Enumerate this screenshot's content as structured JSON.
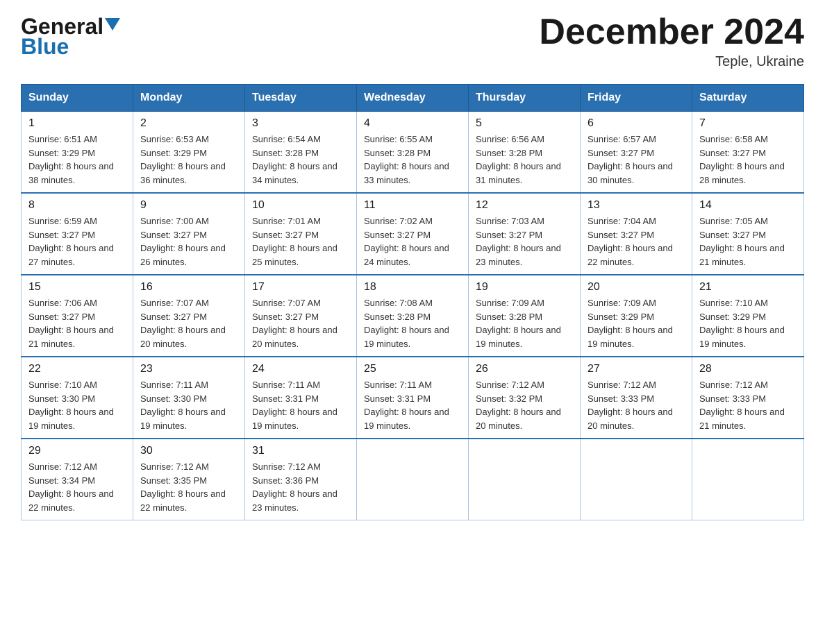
{
  "logo": {
    "general": "General",
    "blue": "Blue",
    "triangle": "▼"
  },
  "title": {
    "month_year": "December 2024",
    "location": "Teple, Ukraine"
  },
  "header_days": [
    "Sunday",
    "Monday",
    "Tuesday",
    "Wednesday",
    "Thursday",
    "Friday",
    "Saturday"
  ],
  "weeks": [
    [
      {
        "day": "1",
        "sunrise": "6:51 AM",
        "sunset": "3:29 PM",
        "daylight": "8 hours and 38 minutes."
      },
      {
        "day": "2",
        "sunrise": "6:53 AM",
        "sunset": "3:29 PM",
        "daylight": "8 hours and 36 minutes."
      },
      {
        "day": "3",
        "sunrise": "6:54 AM",
        "sunset": "3:28 PM",
        "daylight": "8 hours and 34 minutes."
      },
      {
        "day": "4",
        "sunrise": "6:55 AM",
        "sunset": "3:28 PM",
        "daylight": "8 hours and 33 minutes."
      },
      {
        "day": "5",
        "sunrise": "6:56 AM",
        "sunset": "3:28 PM",
        "daylight": "8 hours and 31 minutes."
      },
      {
        "day": "6",
        "sunrise": "6:57 AM",
        "sunset": "3:27 PM",
        "daylight": "8 hours and 30 minutes."
      },
      {
        "day": "7",
        "sunrise": "6:58 AM",
        "sunset": "3:27 PM",
        "daylight": "8 hours and 28 minutes."
      }
    ],
    [
      {
        "day": "8",
        "sunrise": "6:59 AM",
        "sunset": "3:27 PM",
        "daylight": "8 hours and 27 minutes."
      },
      {
        "day": "9",
        "sunrise": "7:00 AM",
        "sunset": "3:27 PM",
        "daylight": "8 hours and 26 minutes."
      },
      {
        "day": "10",
        "sunrise": "7:01 AM",
        "sunset": "3:27 PM",
        "daylight": "8 hours and 25 minutes."
      },
      {
        "day": "11",
        "sunrise": "7:02 AM",
        "sunset": "3:27 PM",
        "daylight": "8 hours and 24 minutes."
      },
      {
        "day": "12",
        "sunrise": "7:03 AM",
        "sunset": "3:27 PM",
        "daylight": "8 hours and 23 minutes."
      },
      {
        "day": "13",
        "sunrise": "7:04 AM",
        "sunset": "3:27 PM",
        "daylight": "8 hours and 22 minutes."
      },
      {
        "day": "14",
        "sunrise": "7:05 AM",
        "sunset": "3:27 PM",
        "daylight": "8 hours and 21 minutes."
      }
    ],
    [
      {
        "day": "15",
        "sunrise": "7:06 AM",
        "sunset": "3:27 PM",
        "daylight": "8 hours and 21 minutes."
      },
      {
        "day": "16",
        "sunrise": "7:07 AM",
        "sunset": "3:27 PM",
        "daylight": "8 hours and 20 minutes."
      },
      {
        "day": "17",
        "sunrise": "7:07 AM",
        "sunset": "3:27 PM",
        "daylight": "8 hours and 20 minutes."
      },
      {
        "day": "18",
        "sunrise": "7:08 AM",
        "sunset": "3:28 PM",
        "daylight": "8 hours and 19 minutes."
      },
      {
        "day": "19",
        "sunrise": "7:09 AM",
        "sunset": "3:28 PM",
        "daylight": "8 hours and 19 minutes."
      },
      {
        "day": "20",
        "sunrise": "7:09 AM",
        "sunset": "3:29 PM",
        "daylight": "8 hours and 19 minutes."
      },
      {
        "day": "21",
        "sunrise": "7:10 AM",
        "sunset": "3:29 PM",
        "daylight": "8 hours and 19 minutes."
      }
    ],
    [
      {
        "day": "22",
        "sunrise": "7:10 AM",
        "sunset": "3:30 PM",
        "daylight": "8 hours and 19 minutes."
      },
      {
        "day": "23",
        "sunrise": "7:11 AM",
        "sunset": "3:30 PM",
        "daylight": "8 hours and 19 minutes."
      },
      {
        "day": "24",
        "sunrise": "7:11 AM",
        "sunset": "3:31 PM",
        "daylight": "8 hours and 19 minutes."
      },
      {
        "day": "25",
        "sunrise": "7:11 AM",
        "sunset": "3:31 PM",
        "daylight": "8 hours and 19 minutes."
      },
      {
        "day": "26",
        "sunrise": "7:12 AM",
        "sunset": "3:32 PM",
        "daylight": "8 hours and 20 minutes."
      },
      {
        "day": "27",
        "sunrise": "7:12 AM",
        "sunset": "3:33 PM",
        "daylight": "8 hours and 20 minutes."
      },
      {
        "day": "28",
        "sunrise": "7:12 AM",
        "sunset": "3:33 PM",
        "daylight": "8 hours and 21 minutes."
      }
    ],
    [
      {
        "day": "29",
        "sunrise": "7:12 AM",
        "sunset": "3:34 PM",
        "daylight": "8 hours and 22 minutes."
      },
      {
        "day": "30",
        "sunrise": "7:12 AM",
        "sunset": "3:35 PM",
        "daylight": "8 hours and 22 minutes."
      },
      {
        "day": "31",
        "sunrise": "7:12 AM",
        "sunset": "3:36 PM",
        "daylight": "8 hours and 23 minutes."
      },
      null,
      null,
      null,
      null
    ]
  ]
}
